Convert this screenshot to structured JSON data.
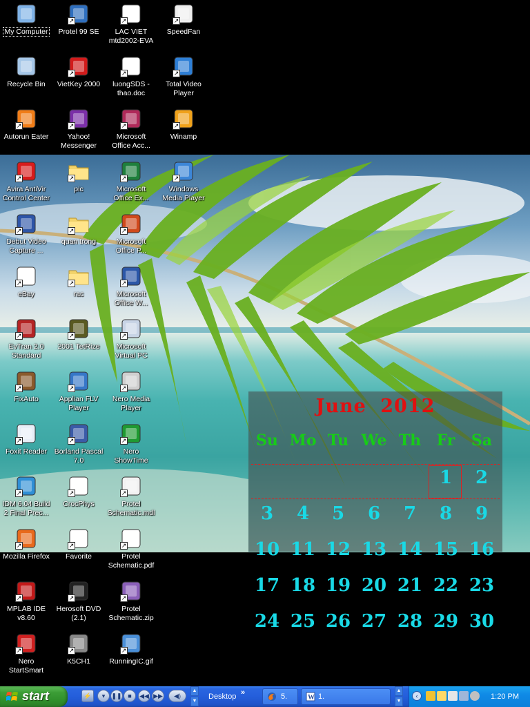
{
  "desktop": {
    "icons": [
      {
        "label": "My Computer",
        "icon": "my-computer-icon"
      },
      {
        "label": "Protel 99 SE",
        "icon": "protel-icon"
      },
      {
        "label": "LAC VIET\nmtd2002-EVA",
        "icon": "lacviet-icon"
      },
      {
        "label": "SpeedFan",
        "icon": "fan-icon"
      },
      {
        "label": "Recycle Bin",
        "icon": "recycle-bin-icon"
      },
      {
        "label": "VietKey 2000",
        "icon": "vietkey-icon"
      },
      {
        "label": "luongSDS -\nthao.doc",
        "icon": "word-doc-icon"
      },
      {
        "label": "Total Video\nPlayer",
        "icon": "play-icon"
      },
      {
        "label": "Autorun Eater",
        "icon": "cone-icon"
      },
      {
        "label": "Yahoo!\nMessenger",
        "icon": "yahoo-icon"
      },
      {
        "label": "Microsoft\nOffice Acc...",
        "icon": "access-icon"
      },
      {
        "label": "Winamp",
        "icon": "winamp-icon"
      },
      {
        "label": "Avira AntiVir\nControl Center",
        "icon": "umbrella-icon"
      },
      {
        "label": "pic",
        "icon": "folder-icon"
      },
      {
        "label": "Microsoft\nOffice Ex...",
        "icon": "excel-icon"
      },
      {
        "label": "Windows\nMedia Player",
        "icon": "media-player-icon"
      },
      {
        "label": "Debut Video\nCapture ...",
        "icon": "film-icon"
      },
      {
        "label": "quan trong",
        "icon": "folder-icon"
      },
      {
        "label": "Microsoft\nOffice P...",
        "icon": "powerpoint-icon"
      },
      {
        "label": "eBay",
        "icon": "ebay-icon"
      },
      {
        "label": "rac",
        "icon": "folder-icon"
      },
      {
        "label": "Microsoft\nOffice W...",
        "icon": "word-icon"
      },
      {
        "label": "EvTran 2.0\nStandard",
        "icon": "evtran-icon"
      },
      {
        "label": "2001 TetRize",
        "icon": "tetrize-icon"
      },
      {
        "label": "Microsoft\nVirtual PC",
        "icon": "virtual-pc-icon"
      },
      {
        "label": "FixAuto",
        "icon": "hammer-icon"
      },
      {
        "label": "Applian FLV\nPlayer",
        "icon": "flv-icon"
      },
      {
        "label": "Nero Media\nPlayer",
        "icon": "nero-media-icon"
      },
      {
        "label": "Foxit Reader",
        "icon": "foxit-icon"
      },
      {
        "label": "Borland Pascal\n7.0",
        "icon": "pascal-icon"
      },
      {
        "label": "Nero\nShowTime",
        "icon": "showtime-icon"
      },
      {
        "label": "IDM 6.04 Build\n2 Final Prec...",
        "icon": "idm-icon"
      },
      {
        "label": "CrocPhys",
        "icon": "window-app-icon"
      },
      {
        "label": "Protel\nSchematic.mdl",
        "icon": "document-icon"
      },
      {
        "label": "Mozilla Firefox",
        "icon": "firefox-icon"
      },
      {
        "label": "Favorite",
        "icon": "window-app-icon"
      },
      {
        "label": "Protel\nSchematic.pdf",
        "icon": "pdf-icon"
      },
      {
        "label": "MPLAB IDE\nv8.60",
        "icon": "mplab-icon"
      },
      {
        "label": "Herosoft DVD\n(2.1)",
        "icon": "herosoft-icon"
      },
      {
        "label": "Protel\nSchematic.zip",
        "icon": "zip-icon"
      },
      {
        "label": "Nero\nStartSmart",
        "icon": "nero-icon"
      },
      {
        "label": "K5CH1",
        "icon": "chip-icon"
      },
      {
        "label": "RunningIC.gif",
        "icon": "gif-icon"
      }
    ]
  },
  "calendar": {
    "title": "June  2012",
    "weekdays": [
      "Su",
      "Mo",
      "Tu",
      "We",
      "Th",
      "Fr",
      "Sa"
    ],
    "today": "1",
    "weeks": [
      [
        "",
        "",
        "",
        "",
        "",
        "1",
        "2"
      ],
      [
        "3",
        "4",
        "5",
        "6",
        "7",
        "8",
        "9"
      ],
      [
        "10",
        "11",
        "12",
        "13",
        "14",
        "15",
        "16"
      ],
      [
        "17",
        "18",
        "19",
        "20",
        "21",
        "22",
        "23"
      ],
      [
        "24",
        "25",
        "26",
        "27",
        "28",
        "29",
        "30"
      ]
    ],
    "colors": {
      "title": "#e01010",
      "weekdays": "#17cc17",
      "days": "#19d9e6"
    }
  },
  "taskbar": {
    "start_label": "start",
    "desktop_toolbar_label": "Desktop",
    "toolbar_chevron": "»",
    "tasks": [
      {
        "label": "5.",
        "icon": "firefox-icon"
      },
      {
        "label": "1.",
        "icon": "word-icon"
      }
    ],
    "clock": "1:20 PM"
  }
}
